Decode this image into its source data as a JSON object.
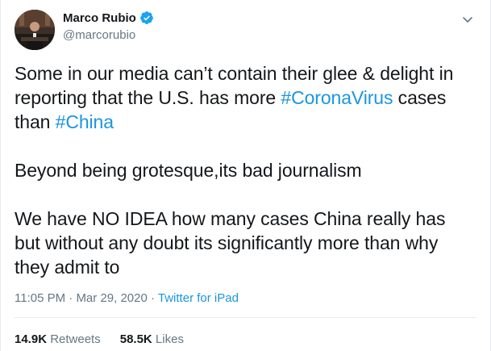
{
  "user": {
    "display_name": "Marco Rubio",
    "handle": "@marcorubio",
    "verified": true
  },
  "tweet": {
    "line1_text": "Some in our media can’t contain their glee & delight in reporting that the U.S. has more ",
    "hashtag1": "#CoronaVirus",
    "line1_mid": " cases than ",
    "hashtag2": "#China",
    "para2": "Beyond being grotesque,its bad journalism",
    "para3": "We have NO IDEA how many cases China really has but without any doubt its significantly more than why they admit to"
  },
  "meta": {
    "time": "11:05 PM",
    "separator": " · ",
    "date": "Mar 29, 2020",
    "separator2": " · ",
    "source": "Twitter for iPad"
  },
  "stats": {
    "retweets_count": "14.9K",
    "retweets_label": " Retweets",
    "likes_count": "58.5K",
    "likes_label": " Likes"
  },
  "colors": {
    "link": "#1b95e0",
    "verified_badge": "#1da1f2",
    "secondary_text": "#657786"
  },
  "icons": {
    "verified": "verified-badge-icon",
    "menu": "chevron-down-icon"
  }
}
